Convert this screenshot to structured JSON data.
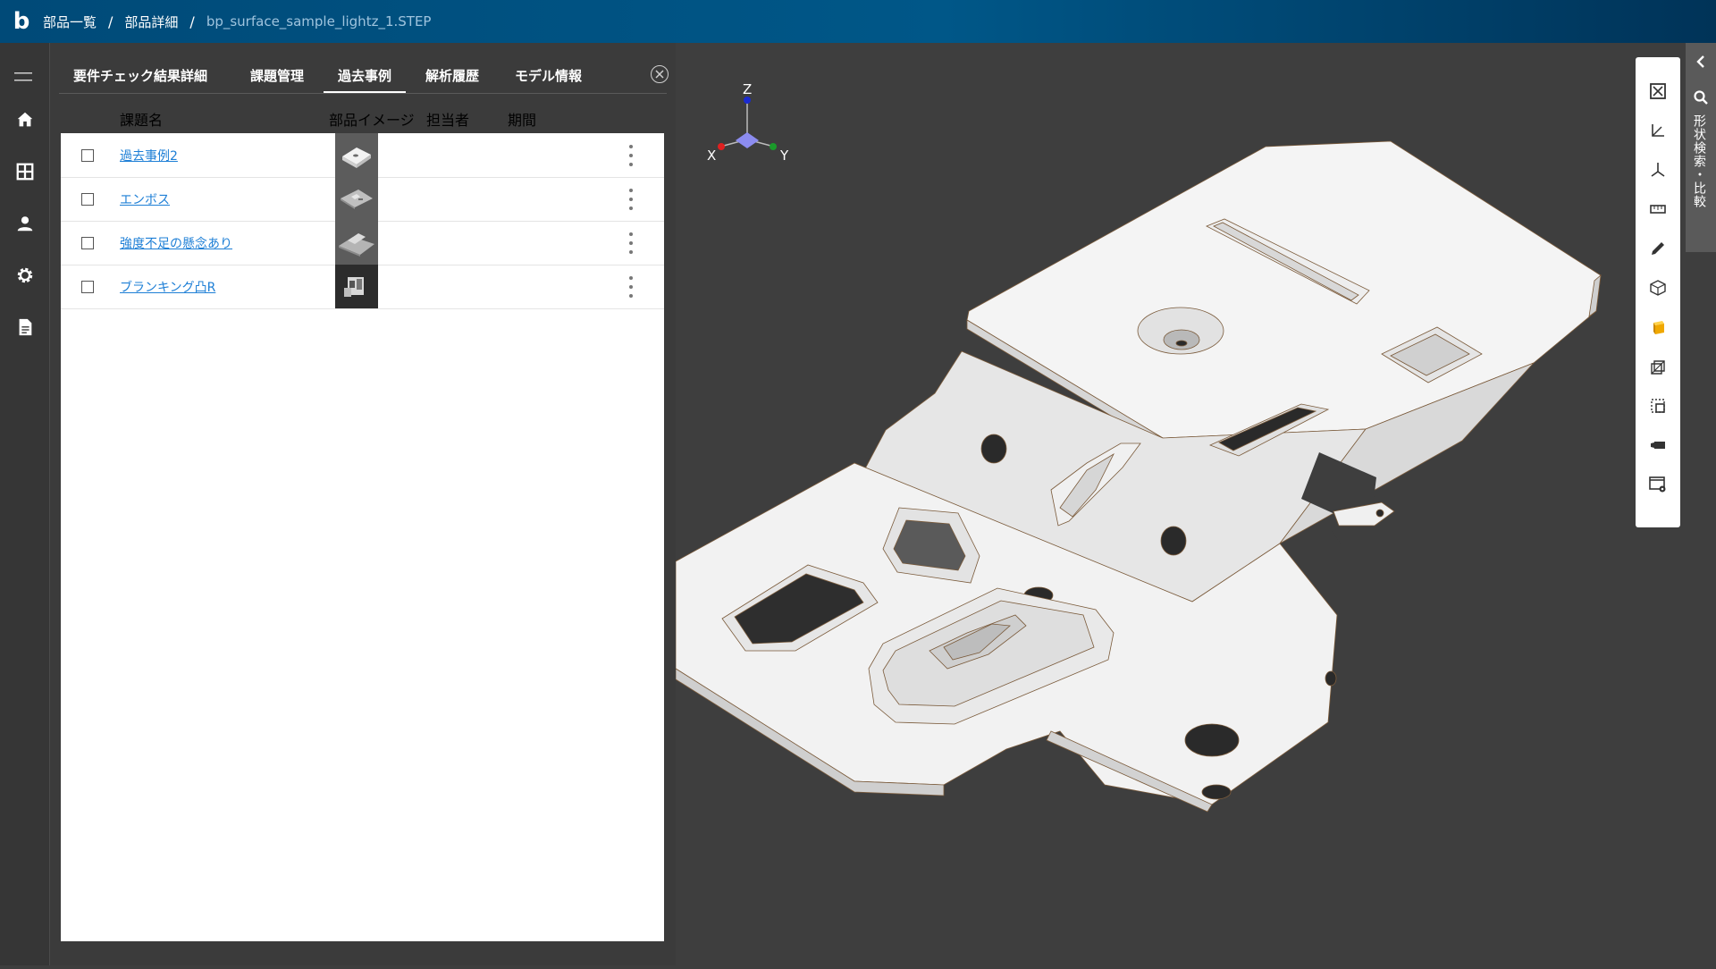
{
  "header": {
    "logo": "b",
    "breadcrumb": [
      {
        "label": "部品一覧"
      },
      {
        "label": "部品詳細"
      },
      {
        "label": "bp_surface_sample_lightz_1.STEP"
      }
    ],
    "separator": "/"
  },
  "nav": {
    "items": [
      {
        "icon": "home-icon"
      },
      {
        "icon": "grid-icon"
      },
      {
        "icon": "user-icon"
      },
      {
        "icon": "gear-icon"
      },
      {
        "icon": "document-icon"
      }
    ]
  },
  "panel": {
    "tabs": [
      {
        "label": "要件チェック結果詳細"
      },
      {
        "label": "課題管理"
      },
      {
        "label": "過去事例",
        "active": true
      },
      {
        "label": "解析履歴"
      },
      {
        "label": "モデル情報"
      }
    ],
    "columns": {
      "name": "課題名",
      "image": "部品イメージ",
      "assignee": "担当者",
      "period": "期間"
    },
    "rows": [
      {
        "title": "過去事例2",
        "assignee": "",
        "period": ""
      },
      {
        "title": "エンボス",
        "assignee": "",
        "period": ""
      },
      {
        "title": "強度不足の懸念あり",
        "assignee": "",
        "period": ""
      },
      {
        "title": "ブランキング凸R",
        "assignee": "",
        "period": ""
      }
    ]
  },
  "viewport": {
    "axes": {
      "x": "X",
      "y": "Y",
      "z": "Z"
    },
    "axis_colors": {
      "x": "#e02020",
      "y": "#1a9a2a",
      "z": "#1a2ad0"
    }
  },
  "toolbar": {
    "tools": [
      {
        "icon": "fit-view-icon"
      },
      {
        "icon": "axis-dimension-icon"
      },
      {
        "icon": "coordinate-axes-icon"
      },
      {
        "icon": "ruler-icon"
      },
      {
        "icon": "pen-icon"
      },
      {
        "icon": "wireframe-cube-icon"
      },
      {
        "icon": "solid-cube-icon"
      },
      {
        "icon": "section-cube-icon"
      },
      {
        "icon": "selection-box-icon"
      },
      {
        "icon": "camera-icon"
      },
      {
        "icon": "window-settings-icon"
      }
    ]
  },
  "side_panel": {
    "label": "形状検索・比較"
  },
  "colors": {
    "header": "#005788",
    "link": "#1e7fd6",
    "viewport_bg": "#3e3e3e",
    "accent_cube": "#f0a800"
  }
}
